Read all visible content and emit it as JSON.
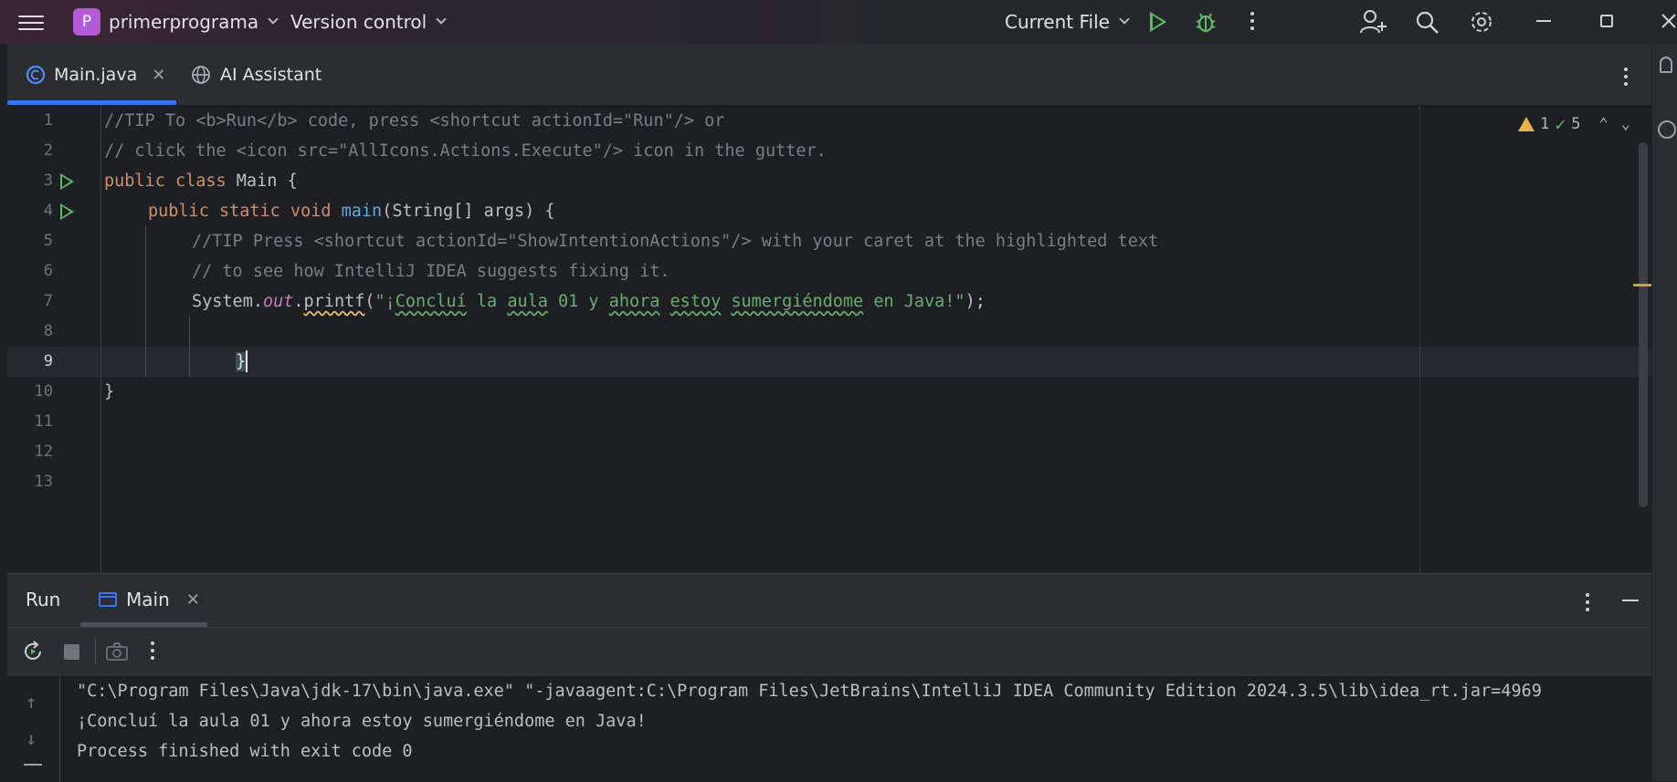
{
  "titlebar": {
    "project_initial": "P",
    "project_name": "primerprograma",
    "version_control": "Version control",
    "run_config": "Current File",
    "colors": {
      "project_badge": "#b35ad6",
      "run": "#5fb865",
      "accent": "#3574f0"
    }
  },
  "tabs": [
    {
      "label": "Main.java",
      "active": true,
      "icon": "java-class-icon"
    },
    {
      "label": "AI Assistant",
      "active": false,
      "icon": "globe-icon"
    }
  ],
  "editor": {
    "line_numbers": [
      "1",
      "2",
      "3",
      "4",
      "5",
      "6",
      "7",
      "8",
      "9",
      "10",
      "11",
      "12",
      "13"
    ],
    "current_line": "9",
    "inspections": {
      "warnings": "1",
      "ok": "5"
    },
    "lines": {
      "l1": "//TIP To <b>Run</b> code, press <shortcut actionId=\"Run\"/> or",
      "l2": "// click the <icon src=\"AllIcons.Actions.Execute\"/> icon in the gutter.",
      "l3_kw": "public class ",
      "l3_name": "Main {",
      "l4_kw": "public static void ",
      "l4_fn": "main",
      "l4_rest": "(String[] args) {",
      "l5": "//TIP Press <shortcut actionId=\"ShowIntentionActions\"/> with your caret at the highlighted text",
      "l6": "// to see how IntelliJ IDEA suggests fixing it.",
      "l7_sys": "System.",
      "l7_out": "out",
      "l7_dot": ".",
      "l7_fn": "printf",
      "l7_open": "(",
      "l7_q1": "\"¡",
      "l7_w1": "Concluí",
      "l7_s1": " la ",
      "l7_w2": "aula",
      "l7_s2": " 01 y ",
      "l7_w3": "ahora",
      "l7_s3": " ",
      "l7_w4": "estoy",
      "l7_s4": " ",
      "l7_w5": "sumergiéndome",
      "l7_s5": " en Java!\"",
      "l7_close": ");",
      "l9": "}",
      "l10": "}"
    }
  },
  "run": {
    "title": "Run",
    "tab_label": "Main",
    "output": [
      "\"C:\\Program Files\\Java\\jdk-17\\bin\\java.exe\" \"-javaagent:C:\\Program Files\\JetBrains\\IntelliJ IDEA Community Edition 2024.3.5\\lib\\idea_rt.jar=4969",
      "¡Concluí la aula 01 y ahora estoy sumergiéndome en Java!",
      "Process finished with exit code 0"
    ]
  }
}
